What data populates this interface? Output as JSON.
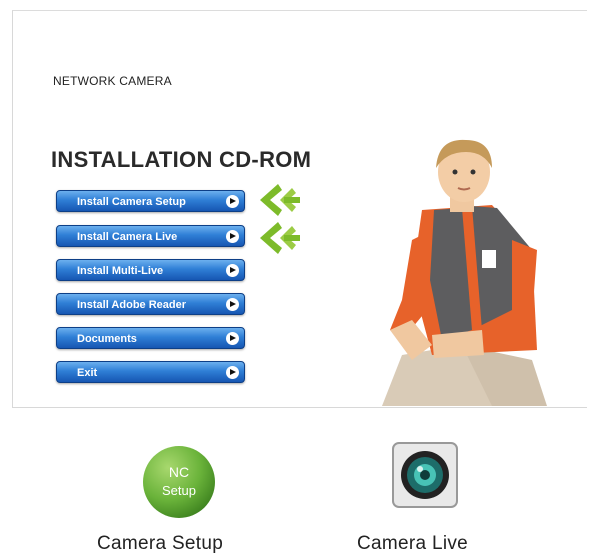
{
  "window": {
    "subtitle": "NETWORK CAMERA",
    "title": "INSTALLATION CD-ROM"
  },
  "menu": [
    {
      "label": "Install Camera Setup",
      "highlighted": true
    },
    {
      "label": "Install Camera Live",
      "highlighted": true
    },
    {
      "label": "Install Multi-Live",
      "highlighted": false
    },
    {
      "label": "Install Adobe Reader",
      "highlighted": false
    },
    {
      "label": "Documents",
      "highlighted": false
    },
    {
      "label": "Exit",
      "highlighted": false
    }
  ],
  "icons": {
    "nc_setup": {
      "line1": "NC",
      "line2": "Setup",
      "caption": "Camera Setup"
    },
    "camera_live": {
      "caption": "Camera Live"
    }
  },
  "colors": {
    "button_blue": "#2f7fd6",
    "arrow_green": "#7dbb2a",
    "nc_green": "#6ab33a"
  }
}
